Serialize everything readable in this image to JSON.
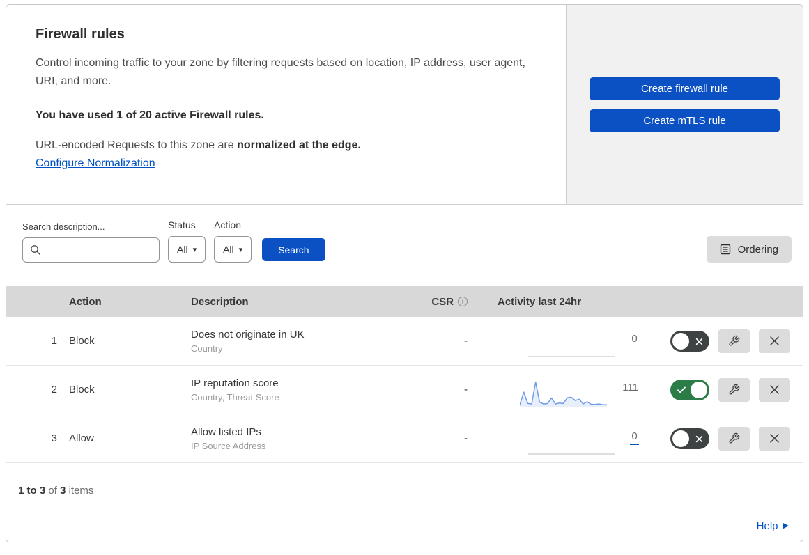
{
  "header": {
    "title": "Firewall rules",
    "description": "Control incoming traffic to your zone by filtering requests based on location, IP address, user agent, URI, and more.",
    "usage": "You have used 1 of 20 active Firewall rules.",
    "normalization_regular": "URL-encoded Requests to this zone are ",
    "normalization_bold": "normalized at the edge.",
    "configure_link": "Configure Normalization",
    "create_firewall_button": "Create firewall rule",
    "create_mtls_button": "Create mTLS rule"
  },
  "filters": {
    "search_label": "Search description...",
    "status_label": "Status",
    "status_value": "All",
    "action_label": "Action",
    "action_value": "All",
    "search_button": "Search",
    "ordering_button": "Ordering"
  },
  "table": {
    "headers": {
      "action": "Action",
      "description": "Description",
      "csr": "CSR",
      "activity": "Activity last 24hr"
    },
    "rows": [
      {
        "priority": "1",
        "action": "Block",
        "description": "Does not originate in UK",
        "fields": "Country",
        "csr": "-",
        "activity_count": "0",
        "enabled": false
      },
      {
        "priority": "2",
        "action": "Block",
        "description": "IP reputation score",
        "fields": "Country, Threat Score",
        "csr": "-",
        "activity_count": "111",
        "enabled": true,
        "sparkline": [
          5,
          55,
          10,
          8,
          95,
          15,
          8,
          10,
          32,
          8,
          12,
          10,
          33,
          35,
          22,
          27,
          8,
          17,
          7,
          6,
          8,
          5,
          5
        ]
      },
      {
        "priority": "3",
        "action": "Allow",
        "description": "Allow listed IPs",
        "fields": "IP Source Address",
        "csr": "-",
        "activity_count": "0",
        "enabled": false
      }
    ],
    "footer": {
      "range": "1 to 3",
      "of": "of",
      "total": "3",
      "items": "items"
    }
  },
  "help": {
    "label": "Help"
  },
  "colors": {
    "accent_blue": "#0051c3",
    "button_blue": "#0b51c4",
    "toggle_on_green": "#2c7c47",
    "toggle_off_gray": "#3f4242",
    "sparkline_blue": "#6f9ce8",
    "sparkline_fill": "#e9effa",
    "flat_line_gray": "#bcbcbc"
  }
}
